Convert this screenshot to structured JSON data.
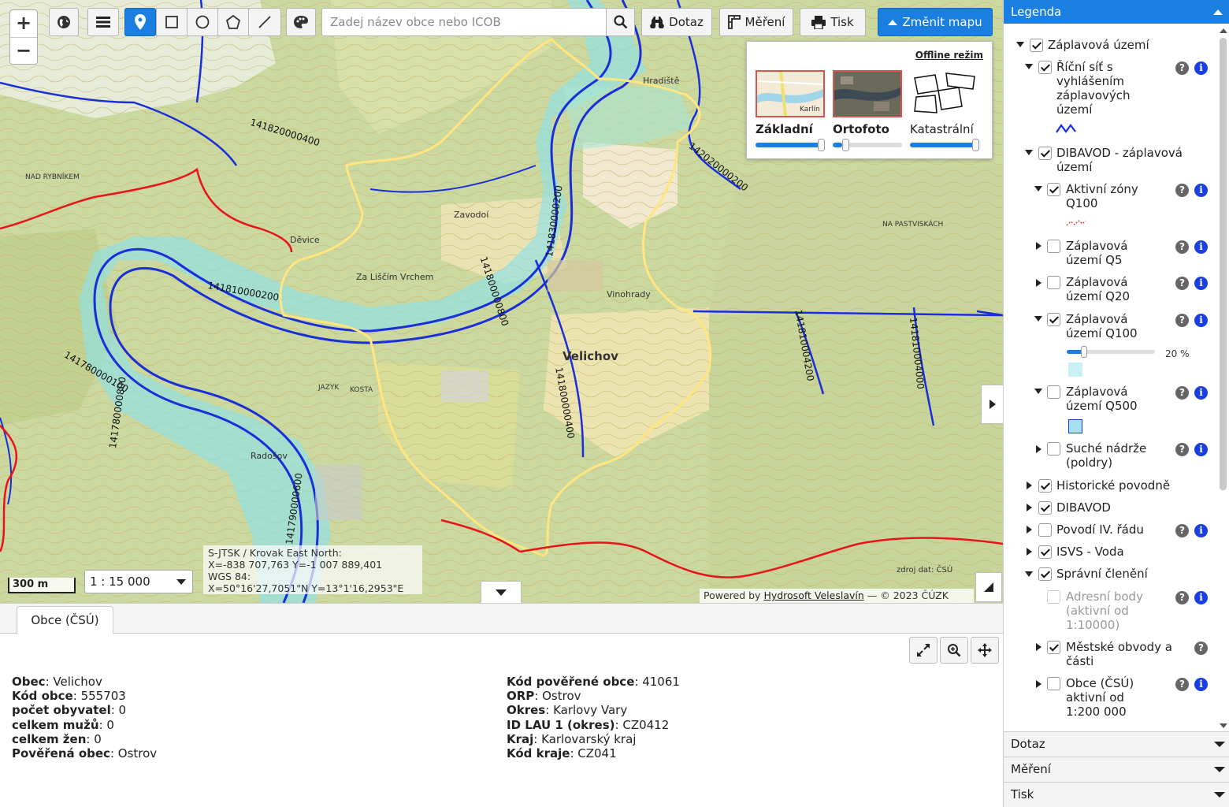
{
  "toolbar": {
    "search_placeholder": "Zadej název obce nebo ICOB",
    "query_label": "Dotaz",
    "measure_label": "Měření",
    "print_label": "Tisk",
    "change_map_label": "Změnit mapu",
    "zoom_in": "+",
    "zoom_out": "−"
  },
  "basemaps": {
    "offline_label": "Offline režim",
    "items": [
      {
        "name": "Základní",
        "opacity": 1.0,
        "selected": true
      },
      {
        "name": "Ortofoto",
        "opacity": 0.05,
        "selected": false
      },
      {
        "name": "Katastrální",
        "opacity": 1.0,
        "selected": false
      }
    ]
  },
  "map": {
    "town_label": "Velichov",
    "labels": [
      "Děvice",
      "Za Liščím Vrchem",
      "Zavodoí",
      "Vinohrady",
      "Radošov",
      "Hradiště",
      "NA PASTVISKÁCH",
      "NAD RYBNÍKEM",
      "JAZYK",
      "KOSTA"
    ],
    "reach_codes": [
      "141820000400",
      "142020000200",
      "141830000200",
      "141810000200",
      "141780000100",
      "141780000800",
      "141800000800",
      "141800000400",
      "141810004200",
      "141810004000",
      "141790000600"
    ],
    "scale_bar": "300 m",
    "scale_select": "1 : 15 000",
    "coords": {
      "line1": "S-JTSK / Krovak East North:",
      "line2": "X=-838 707,763 Y=-1 007 889,401",
      "line3": "WGS 84:",
      "line4": "X=50°16'27,7051\"N Y=13°1'16,2953\"E"
    },
    "source_note": "zdroj dat: ČSÚ",
    "credits_prefix": "Powered by",
    "credits_link": "Hydrosoft Veleslavín",
    "credits_suffix": "— © 2023 ČÚZK"
  },
  "bottom": {
    "tab_label": "Obce (ČSÚ)",
    "left_attrs": [
      {
        "k": "Obec",
        "v": "Velichov"
      },
      {
        "k": "Kód obce",
        "v": "555703"
      },
      {
        "k": "počet obyvatel",
        "v": "0"
      },
      {
        "k": "celkem mužů",
        "v": "0"
      },
      {
        "k": "celkem žen",
        "v": "0"
      },
      {
        "k": "Pověřená obec",
        "v": "Ostrov"
      }
    ],
    "right_attrs": [
      {
        "k": "Kód pověřené obce",
        "v": "41061"
      },
      {
        "k": "ORP",
        "v": "Ostrov"
      },
      {
        "k": "Okres",
        "v": "Karlovy Vary"
      },
      {
        "k": "ID LAU 1 (okres)",
        "v": "CZ0412"
      },
      {
        "k": "Kraj",
        "v": "Karlovarský kraj"
      },
      {
        "k": "Kód kraje",
        "v": "CZ041"
      }
    ]
  },
  "legend": {
    "title": "Legenda",
    "items": {
      "zaplavova": "Záplavová území",
      "ricni_1": "Říční síť s",
      "ricni_2": "vyhlášením",
      "ricni_3": "záplavových",
      "ricni_4": "území",
      "dibavod_z_1": "DIBAVOD - záplavová",
      "dibavod_z_2": "území",
      "aktivni_1": "Aktivní zóny",
      "aktivni_2": "Q100",
      "q5_1": "Záplavová",
      "q5_2": "území Q5",
      "q20_1": "Záplavová",
      "q20_2": "území Q20",
      "q100_1": "Záplavová",
      "q100_2": "území Q100",
      "q100_opacity": "20 %",
      "q500_1": "Záplavová",
      "q500_2": "území Q500",
      "sucha_1": "Suché nádrže",
      "sucha_2": "(poldry)",
      "historicke": "Historické povodně",
      "dibavod": "DIBAVOD",
      "povodi": "Povodí IV. řádu",
      "isvs": "ISVS - Voda",
      "spravni": "Správní členění",
      "adresni_1": "Adresní body",
      "adresni_2": "(aktivní od",
      "adresni_3": "1:10000)",
      "mestske_1": "Městské obvody a",
      "mestske_2": "části",
      "obce_1": "Obce (ČSÚ)",
      "obce_2": "aktivní od",
      "obce_3": "1:200 000"
    }
  },
  "accordions": {
    "query": "Dotaz",
    "measure": "Měření",
    "print": "Tisk"
  },
  "colors": {
    "accent": "#1a7fe0",
    "river": "#1a2fd8",
    "boundary": "#ffe680",
    "district": "#e8141c",
    "floodzone": "#7fe0f0"
  }
}
